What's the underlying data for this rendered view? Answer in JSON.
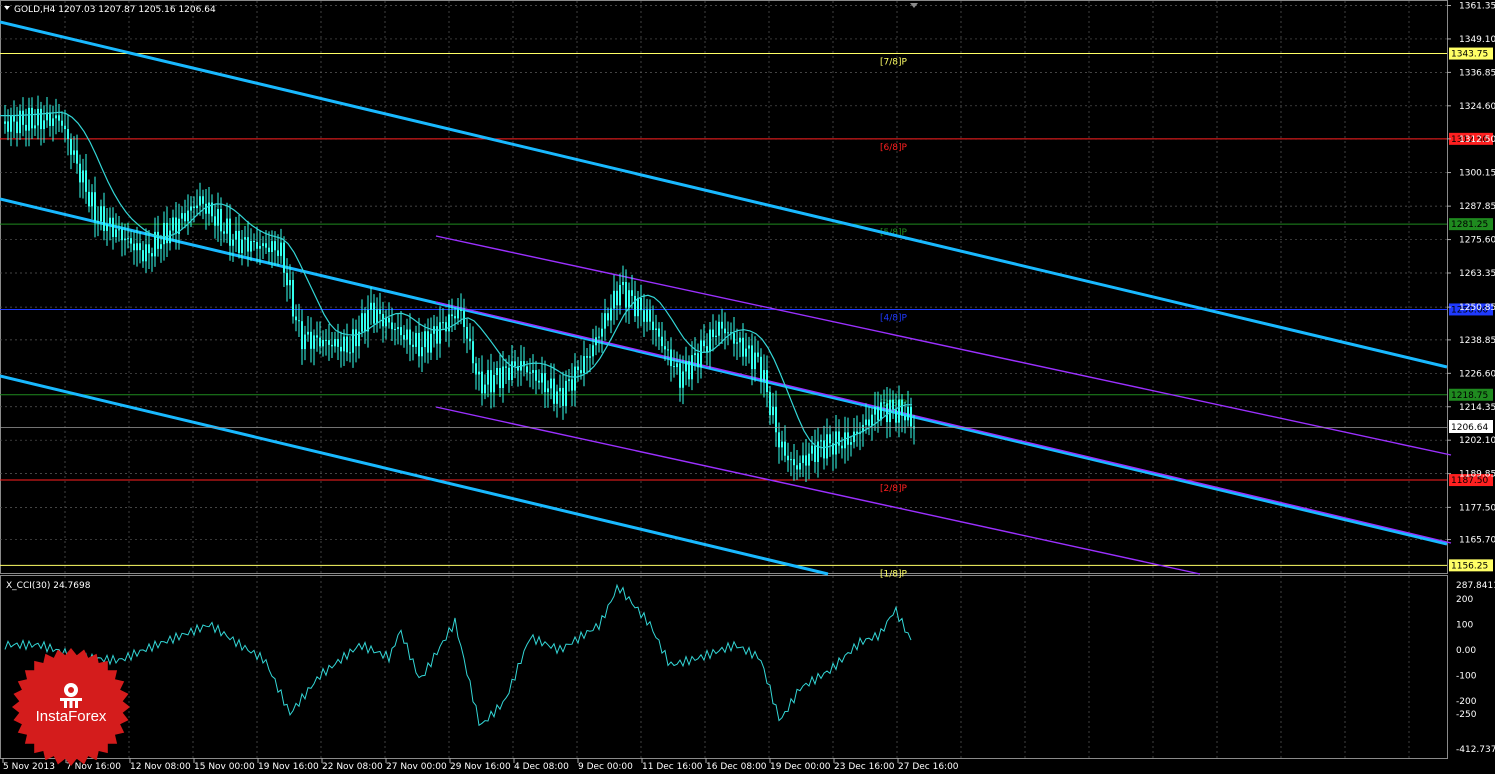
{
  "main": {
    "symbol_header": "GOLD,H4  1207.03 1207.87 1205.16 1206.64",
    "current_price": "1206.64",
    "y_ticks": [
      "1361.35",
      "1349.10",
      "1336.85",
      "1324.60",
      "1312.50",
      "1300.15",
      "1287.85",
      "1275.60",
      "1263.35",
      "1250.85",
      "1238.85",
      "1226.60",
      "1214.35",
      "1202.10",
      "1189.85",
      "1177.50",
      "1165.70"
    ],
    "y_range": [
      1153.45,
      1363.0
    ],
    "murrey_levels": [
      {
        "label": "[7/8]P",
        "price": 1343.75,
        "badge": "1343.75",
        "color": "#ffff66",
        "badge_bg": "#ffff66",
        "badge_fg": "#000000"
      },
      {
        "label": "[6/8]P",
        "price": 1312.5,
        "badge": "1312.50",
        "color": "#ff2020",
        "badge_bg": "#ff2020",
        "badge_fg": "#000000"
      },
      {
        "label": "[5/8]P",
        "price": 1281.25,
        "badge": "1281.25",
        "color": "#1f8a1f",
        "badge_bg": "#1f8a1f",
        "badge_fg": "#000000"
      },
      {
        "label": "[4/8]P",
        "price": 1250.0,
        "badge": "1250.00",
        "color": "#1f3aff",
        "badge_bg": "#1f3aff",
        "badge_fg": "#000000"
      },
      {
        "label": "[3/8]P",
        "price": 1218.75,
        "badge": "1218.75",
        "color": "#1f8a1f",
        "badge_bg": "#1f8a1f",
        "badge_fg": "#000000"
      },
      {
        "label": "[2/8]P",
        "price": 1187.5,
        "badge": "1187.50",
        "color": "#ff2020",
        "badge_bg": "#ff2020",
        "badge_fg": "#000000"
      },
      {
        "label": "[1/8]P",
        "price": 1156.25,
        "badge": "1156.25",
        "color": "#ffff66",
        "badge_bg": "#ffff66",
        "badge_fg": "#000000"
      }
    ]
  },
  "indicator": {
    "label": "X_CCI(30) 24.7698",
    "top_value": "287.8411",
    "bottom_value": "-412.7374",
    "ticks": [
      "200",
      "100",
      "0.00",
      "-100",
      "-200",
      "-250"
    ]
  },
  "time_axis": [
    "5 Nov 2013",
    "7 Nov 16:00",
    "12 Nov 08:00",
    "15 Nov 00:00",
    "19 Nov 16:00",
    "22 Nov 08:00",
    "27 Nov 00:00",
    "29 Nov 16:00",
    "4 Dec 08:00",
    "9 Dec 00:00",
    "11 Dec 16:00",
    "16 Dec 08:00",
    "19 Dec 00:00",
    "23 Dec 16:00",
    "27 Dec 16:00"
  ],
  "logo": {
    "text": "InstaForex"
  },
  "colors": {
    "channel_outer": "#19b9ff",
    "channel_inner": "#9b30ff",
    "ma": "#33d6d6",
    "candle": "#33ffee",
    "grid": "#5a5a5a",
    "logo_red": "#d41c1c"
  }
}
